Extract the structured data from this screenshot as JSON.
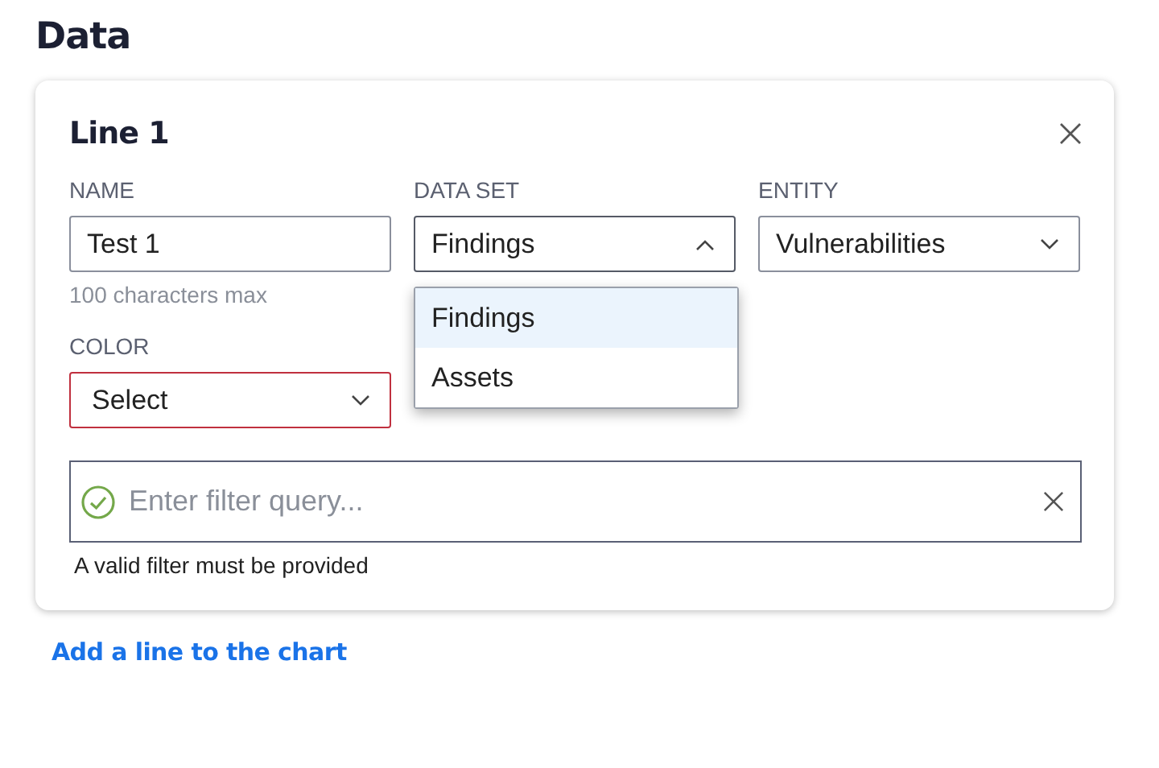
{
  "heading": "Data",
  "card": {
    "title": "Line 1",
    "name_field": {
      "label": "NAME",
      "value": "Test 1",
      "hint": "100 characters max"
    },
    "dataset_field": {
      "label": "DATA SET",
      "value": "Findings",
      "expanded": true,
      "options": [
        {
          "label": "Findings",
          "selected": true
        },
        {
          "label": "Assets",
          "selected": false
        }
      ]
    },
    "entity_field": {
      "label": "ENTITY",
      "value": "Vulnerabilities",
      "expanded": false
    },
    "color_field": {
      "label": "COLOR",
      "value": "Select",
      "invalid": true
    },
    "filter": {
      "placeholder": "Enter filter query...",
      "valid": true,
      "message": "A valid filter must be provided"
    }
  },
  "add_link": "Add a line to the chart"
}
